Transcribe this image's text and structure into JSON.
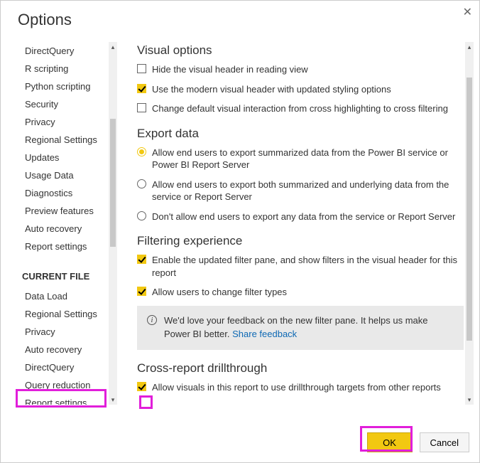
{
  "window": {
    "title": "Options"
  },
  "sidebar": {
    "global_items": [
      "DirectQuery",
      "R scripting",
      "Python scripting",
      "Security",
      "Privacy",
      "Regional Settings",
      "Updates",
      "Usage Data",
      "Diagnostics",
      "Preview features",
      "Auto recovery",
      "Report settings"
    ],
    "current_header": "CURRENT FILE",
    "current_items": [
      "Data Load",
      "Regional Settings",
      "Privacy",
      "Auto recovery",
      "DirectQuery",
      "Query reduction",
      "Report settings"
    ]
  },
  "sections": {
    "visual": {
      "title": "Visual options",
      "hide_header": {
        "label": "Hide the visual header in reading view",
        "checked": false
      },
      "modern_header": {
        "label": "Use the modern visual header with updated styling options",
        "checked": true
      },
      "cross_filter": {
        "label": "Change default visual interaction from cross highlighting to cross filtering",
        "checked": false
      }
    },
    "export": {
      "title": "Export data",
      "summarized": {
        "label": "Allow end users to export summarized data from the Power BI service or Power BI Report Server",
        "selected": true
      },
      "both": {
        "label": "Allow end users to export both summarized and underlying data from the service or Report Server",
        "selected": false
      },
      "none": {
        "label": "Don't allow end users to export any data from the service or Report Server",
        "selected": false
      }
    },
    "filtering": {
      "title": "Filtering experience",
      "enable_pane": {
        "label": "Enable the updated filter pane, and show filters in the visual header for this report",
        "checked": true
      },
      "change_types": {
        "label": "Allow users to change filter types",
        "checked": true
      }
    },
    "feedback": {
      "text": "We'd love your feedback on the new filter pane. It helps us make Power BI better. ",
      "link": "Share feedback"
    },
    "cross_report": {
      "title": "Cross-report drillthrough",
      "allow": {
        "label": "Allow visuals in this report to use drillthrough targets from other reports",
        "checked": true
      }
    }
  },
  "buttons": {
    "ok": "OK",
    "cancel": "Cancel"
  }
}
